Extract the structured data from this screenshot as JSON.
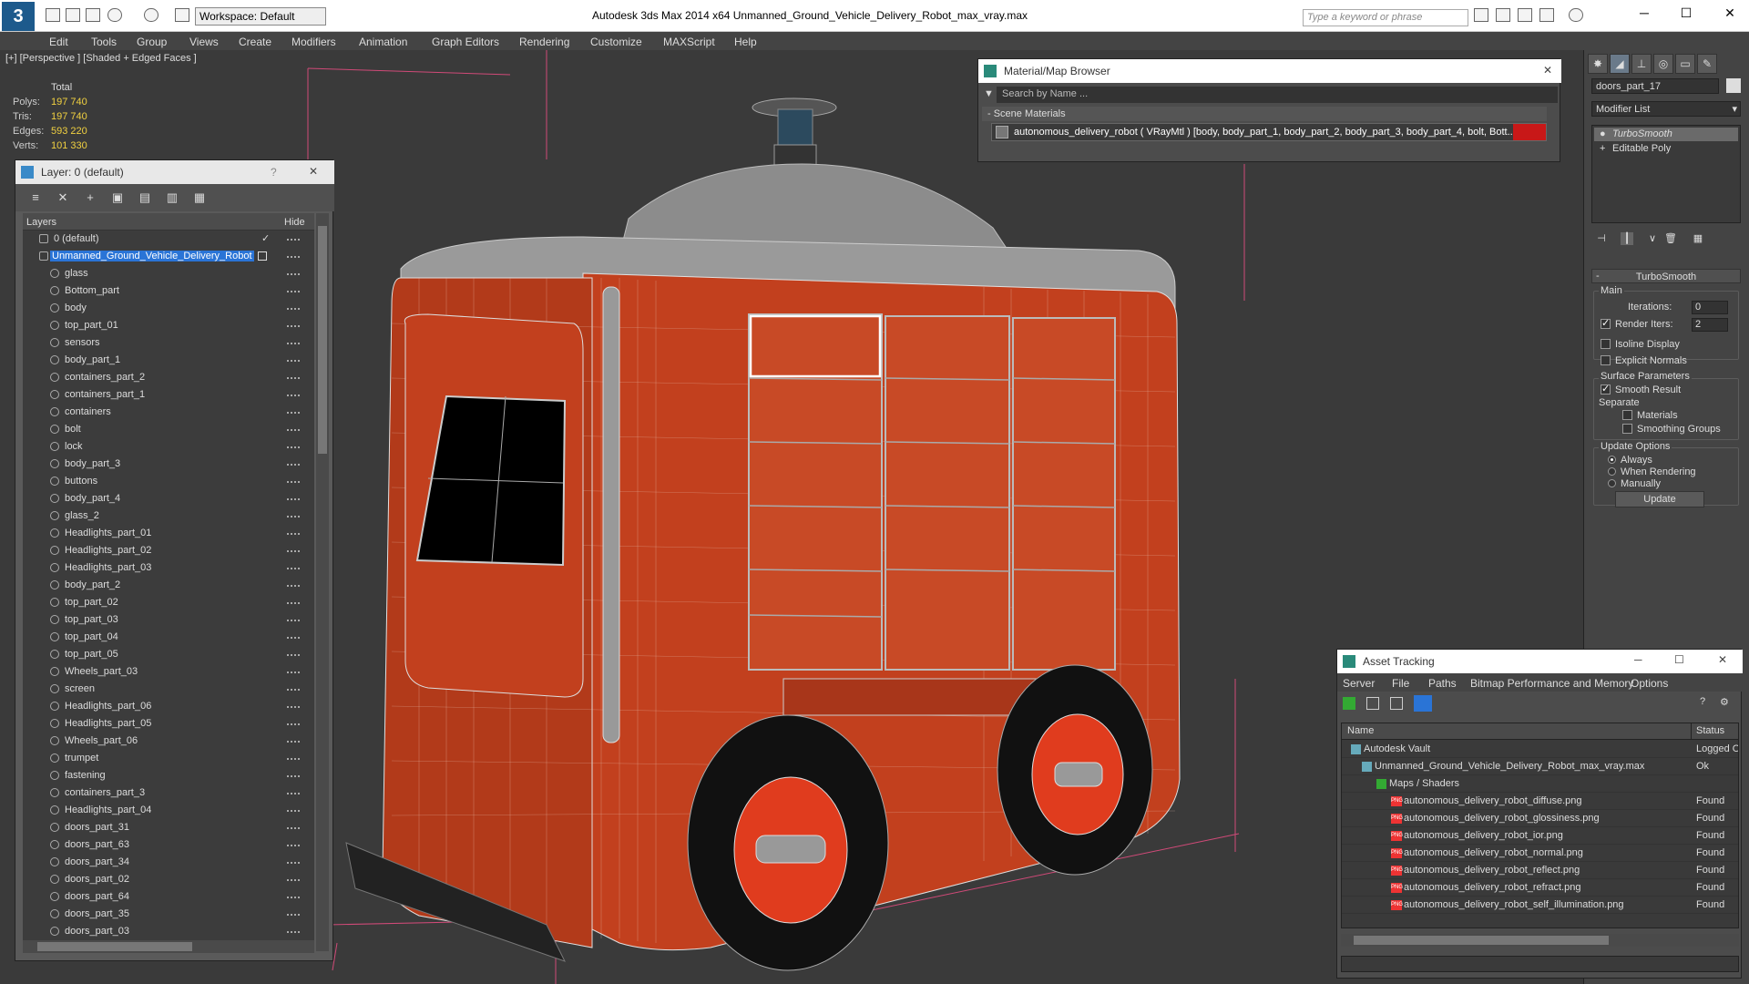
{
  "app": {
    "title": "Autodesk 3ds Max  2014 x64      Unmanned_Ground_Vehicle_Delivery_Robot_max_vray.max",
    "workspace": "Workspace: Default",
    "search_placeholder": "Type a keyword or phrase"
  },
  "menu": [
    "Edit",
    "Tools",
    "Group",
    "Views",
    "Create",
    "Modifiers",
    "Animation",
    "Graph Editors",
    "Rendering",
    "Customize",
    "MAXScript",
    "Help"
  ],
  "viewport": {
    "label": "[+] [Perspective ] [Shaded + Edged Faces ]",
    "stats": {
      "header": "Total",
      "rows": [
        {
          "label": "Polys:",
          "value": "197 740"
        },
        {
          "label": "Tris:",
          "value": "197 740"
        },
        {
          "label": "Edges:",
          "value": "593 220"
        },
        {
          "label": "Verts:",
          "value": "101 330"
        }
      ]
    }
  },
  "layer_panel": {
    "title": "Layer: 0 (default)",
    "help": "?",
    "close": "✕",
    "col_layers": "Layers",
    "col_hide": "Hide",
    "default_layer": "0 (default)",
    "selected_layer": "Unmanned_Ground_Vehicle_Delivery_Robot",
    "objects": [
      "glass",
      "Bottom_part",
      "body",
      "top_part_01",
      "sensors",
      "body_part_1",
      "containers_part_2",
      "containers_part_1",
      "containers",
      "bolt",
      "lock",
      "body_part_3",
      "buttons",
      "body_part_4",
      "glass_2",
      "Headlights_part_01",
      "Headlights_part_02",
      "Headlights_part_03",
      "body_part_2",
      "top_part_02",
      "top_part_03",
      "top_part_04",
      "top_part_05",
      "Wheels_part_03",
      "screen",
      "Headlights_part_06",
      "Headlights_part_05",
      "Wheels_part_06",
      "trumpet",
      "fastening",
      "containers_part_3",
      "Headlights_part_04",
      "doors_part_31",
      "doors_part_63",
      "doors_part_34",
      "doors_part_02",
      "doors_part_64",
      "doors_part_35",
      "doors_part_03"
    ]
  },
  "material_browser": {
    "title": "Material/Map Browser",
    "search": "Search by Name ...",
    "section": "- Scene Materials",
    "item": "autonomous_delivery_robot ( VRayMtl ) [body, body_part_1, body_part_2, body_part_3, body_part_4, bolt, Bott..."
  },
  "command_panel": {
    "object_name": "doors_part_17",
    "modifier_list": "Modifier List",
    "stack": [
      "TurboSmooth",
      "Editable Poly"
    ],
    "rollout_title": "TurboSmooth",
    "main_label": "Main",
    "iterations_label": "Iterations:",
    "iterations_value": "0",
    "render_iters_label": "Render Iters:",
    "render_iters_value": "2",
    "isoline": "Isoline Display",
    "explicit": "Explicit Normals",
    "surface_params": "Surface Parameters",
    "smooth_result": "Smooth Result",
    "separate": "Separate",
    "materials": "Materials",
    "smoothing_groups": "Smoothing Groups",
    "update_options": "Update Options",
    "always": "Always",
    "when_rendering": "When Rendering",
    "manually": "Manually",
    "update_btn": "Update"
  },
  "asset_tracking": {
    "title": "Asset Tracking",
    "menu": [
      "Server",
      "File",
      "Paths",
      "Bitmap Performance and Memory",
      "Options"
    ],
    "col_name": "Name",
    "col_status": "Status",
    "rows": [
      {
        "name": "Autodesk Vault",
        "status": "Logged O",
        "indent": 0
      },
      {
        "name": "Unmanned_Ground_Vehicle_Delivery_Robot_max_vray.max",
        "status": "Ok",
        "indent": 1
      },
      {
        "name": "Maps / Shaders",
        "status": "",
        "indent": 2
      },
      {
        "name": "autonomous_delivery_robot_diffuse.png",
        "status": "Found",
        "indent": 3
      },
      {
        "name": "autonomous_delivery_robot_glossiness.png",
        "status": "Found",
        "indent": 3
      },
      {
        "name": "autonomous_delivery_robot_ior.png",
        "status": "Found",
        "indent": 3
      },
      {
        "name": "autonomous_delivery_robot_normal.png",
        "status": "Found",
        "indent": 3
      },
      {
        "name": "autonomous_delivery_robot_reflect.png",
        "status": "Found",
        "indent": 3
      },
      {
        "name": "autonomous_delivery_robot_refract.png",
        "status": "Found",
        "indent": 3
      },
      {
        "name": "autonomous_delivery_robot_self_illumination.png",
        "status": "Found",
        "indent": 3
      }
    ]
  },
  "colors": {
    "robot_body": "#c2401e",
    "selection": "#2a74d6",
    "stat_value": "#f0d040"
  }
}
